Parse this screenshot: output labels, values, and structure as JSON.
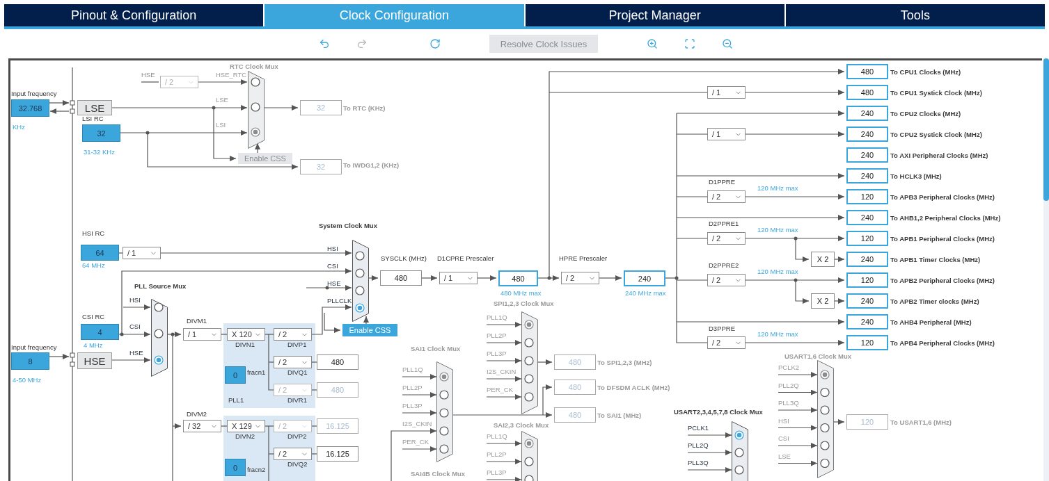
{
  "tabs": [
    {
      "label": "Pinout & Configuration",
      "selected": false
    },
    {
      "label": "Clock Configuration",
      "selected": true
    },
    {
      "label": "Project Manager",
      "selected": false
    },
    {
      "label": "Tools",
      "selected": false
    }
  ],
  "tools": [
    {
      "kind": "undo",
      "disabled": false
    },
    {
      "kind": "redo",
      "disabled": true
    },
    {
      "kind": "reset",
      "disabled": false
    },
    {
      "kind": "resolve",
      "label": "Resolve Clock Issues",
      "disabled": true
    },
    {
      "kind": "zoom-in",
      "disabled": false
    },
    {
      "kind": "fit",
      "disabled": false
    },
    {
      "kind": "zoom-out",
      "disabled": false
    }
  ],
  "diagram": {
    "labels": [
      {
        "text": "Input frequency",
        "kind": "text"
      },
      {
        "text": "KHz",
        "kind": "hint"
      },
      {
        "text": "HSE",
        "kind": "muted"
      },
      {
        "text": "LSI RC",
        "kind": "text"
      },
      {
        "text": "31-32 KHz",
        "kind": "hint"
      },
      {
        "text": "To RTC (KHz)",
        "kind": "caption"
      },
      {
        "text": "To IWDG1,2 (KHz)",
        "kind": "caption"
      },
      {
        "text": "HSI RC",
        "kind": "text"
      },
      {
        "text": "64 MHz",
        "kind": "hint"
      },
      {
        "text": "CSI RC",
        "kind": "text"
      },
      {
        "text": "Input frequency",
        "kind": "text"
      },
      {
        "text": "4 MHz",
        "kind": "hint"
      },
      {
        "text": "4-50 MHz",
        "kind": "hint"
      },
      {
        "text": "DIVM1",
        "kind": "text"
      },
      {
        "text": "DIVN1",
        "kind": "text"
      },
      {
        "text": "DIVP1",
        "kind": "text"
      },
      {
        "text": "fracn1",
        "kind": "text"
      },
      {
        "text": "DIVQ1",
        "kind": "text"
      },
      {
        "text": "PLL1",
        "kind": "text"
      },
      {
        "text": "DIVR1",
        "kind": "text"
      },
      {
        "text": "DIVM2",
        "kind": "text"
      },
      {
        "text": "DIVN2",
        "kind": "text"
      },
      {
        "text": "DIVP2",
        "kind": "text"
      },
      {
        "text": "DIVQ2",
        "kind": "text"
      },
      {
        "text": "fracn2",
        "kind": "text"
      },
      {
        "text": "SYSCLK (MHz)",
        "kind": "text"
      },
      {
        "text": "D1CPRE Prescaler",
        "kind": "text"
      },
      {
        "text": "HPRE Prescaler",
        "kind": "text"
      },
      {
        "text": "480 MHz max",
        "kind": "hint"
      },
      {
        "text": "240 MHz max",
        "kind": "hint"
      },
      {
        "text": "To SPI1,2,3 (MHz)",
        "kind": "caption"
      },
      {
        "text": "To DFSDM ACLK (MHz)",
        "kind": "caption"
      },
      {
        "text": "To SAI1 (MHz)",
        "kind": "caption"
      },
      {
        "text": "D1PPRE",
        "kind": "text"
      },
      {
        "text": "120 MHz max",
        "kind": "hint"
      },
      {
        "text": "D2PPRE1",
        "kind": "text"
      },
      {
        "text": "120 MHz max",
        "kind": "hint"
      },
      {
        "text": "D2PPRE2",
        "kind": "text"
      },
      {
        "text": "120 MHz max",
        "kind": "hint"
      },
      {
        "text": "D3PPRE",
        "kind": "text"
      },
      {
        "text": "120 MHz max",
        "kind": "hint"
      },
      {
        "text": "To USART1,6 (MHz)",
        "kind": "caption"
      },
      {
        "text": "SAI4B Clock Mux",
        "kind": "caption"
      }
    ],
    "value_boxes": [
      {
        "value": "32.768",
        "kind": "input"
      },
      {
        "value": "LSE",
        "kind": "block"
      },
      {
        "value": "32",
        "kind": "input"
      },
      {
        "value": "32",
        "kind": "inactive"
      },
      {
        "value": "32",
        "kind": "inactive"
      },
      {
        "value": "64",
        "kind": "input"
      },
      {
        "value": "4",
        "kind": "input"
      },
      {
        "value": "8",
        "kind": "input"
      },
      {
        "value": "HSE",
        "kind": "block"
      },
      {
        "value": "0",
        "kind": "input"
      },
      {
        "value": "480",
        "kind": "plain"
      },
      {
        "value": "480",
        "kind": "inactive"
      },
      {
        "value": "16.125",
        "kind": "inactive"
      },
      {
        "value": "0",
        "kind": "input"
      },
      {
        "value": "16.125",
        "kind": "plain"
      },
      {
        "value": "480",
        "kind": "plain"
      },
      {
        "value": "480",
        "kind": "result"
      },
      {
        "value": "240",
        "kind": "result"
      },
      {
        "value": "480",
        "kind": "inactive"
      },
      {
        "value": "480",
        "kind": "inactive"
      },
      {
        "value": "480",
        "kind": "inactive"
      },
      {
        "value": "X 2",
        "kind": "plain"
      },
      {
        "value": "X 2",
        "kind": "plain"
      },
      {
        "value": "120",
        "kind": "inactive"
      }
    ],
    "dropdowns": [
      {
        "value": "/ 2",
        "disabled": true
      },
      {
        "value": "/ 1",
        "disabled": false
      },
      {
        "value": "/ 1",
        "disabled": false
      },
      {
        "value": "X 120",
        "disabled": false
      },
      {
        "value": "/ 2",
        "disabled": false
      },
      {
        "value": "/ 2",
        "disabled": false
      },
      {
        "value": "/ 2",
        "disabled": true
      },
      {
        "value": "/ 32",
        "disabled": false
      },
      {
        "value": "X 129",
        "disabled": false
      },
      {
        "value": "/ 2",
        "disabled": true
      },
      {
        "value": "/ 2",
        "disabled": false
      },
      {
        "value": "/ 1",
        "disabled": false
      },
      {
        "value": "/ 2",
        "disabled": false
      },
      {
        "value": "/ 1",
        "disabled": false
      },
      {
        "value": "/ 1",
        "disabled": false
      },
      {
        "value": "/ 2",
        "disabled": false
      },
      {
        "value": "/ 2",
        "disabled": false
      },
      {
        "value": "/ 2",
        "disabled": false
      },
      {
        "value": "/ 2",
        "disabled": false
      }
    ],
    "buttons": [
      {
        "label": "Enable CSS",
        "disabled": true
      },
      {
        "label": "Enable CSS",
        "disabled": false
      }
    ],
    "muxes": [
      {
        "title": "RTC Clock Mux",
        "active": false,
        "inputs": [
          {
            "label": "HSE_RTC",
            "selected": false
          },
          {
            "label": "LSE",
            "selected": false
          },
          {
            "label": "LSI",
            "selected": true
          }
        ]
      },
      {
        "title": "System Clock Mux",
        "active": true,
        "inputs": [
          {
            "label": "HSI",
            "selected": false
          },
          {
            "label": "CSI",
            "selected": false
          },
          {
            "label": "HSE",
            "selected": false
          },
          {
            "label": "PLLCLK",
            "selected": true
          }
        ]
      },
      {
        "title": "PLL Source Mux",
        "active": true,
        "inputs": [
          {
            "label": "HSI",
            "selected": false
          },
          {
            "label": "CSI",
            "selected": false
          },
          {
            "label": "HSE",
            "selected": true
          }
        ]
      },
      {
        "title": "SPI1,2,3 Clock Mux",
        "active": false,
        "inputs": [
          {
            "label": "PLL1Q",
            "selected": true
          },
          {
            "label": "PLL2P",
            "selected": false
          },
          {
            "label": "PLL3P",
            "selected": false
          },
          {
            "label": "I2S_CKIN",
            "selected": false
          },
          {
            "label": "PER_CK",
            "selected": false
          }
        ]
      },
      {
        "title": "SAI1 Clock Mux",
        "active": false,
        "inputs": [
          {
            "label": "PLL1Q",
            "selected": true
          },
          {
            "label": "PLL2P",
            "selected": false
          },
          {
            "label": "PLL3P",
            "selected": false
          },
          {
            "label": "I2S_CKIN",
            "selected": false
          },
          {
            "label": "PER_CK",
            "selected": false
          }
        ]
      },
      {
        "title": "SAI2,3 Clock Mux",
        "active": false,
        "inputs": [
          {
            "label": "PLL1Q",
            "selected": true
          },
          {
            "label": "PLL2P",
            "selected": false
          },
          {
            "label": "PLL3P",
            "selected": false
          }
        ]
      },
      {
        "title": "USART1,6 Clock Mux",
        "active": false,
        "inputs": [
          {
            "label": "PCLK2",
            "selected": true
          },
          {
            "label": "PLL2Q",
            "selected": false
          },
          {
            "label": "PLL3Q",
            "selected": false
          },
          {
            "label": "HSI",
            "selected": false
          },
          {
            "label": "CSI",
            "selected": false
          },
          {
            "label": "LSE",
            "selected": false
          }
        ]
      },
      {
        "title": "USART2,3,4,5,7,8 Clock Mux",
        "active": true,
        "inputs": [
          {
            "label": "PCLK1",
            "selected": true
          },
          {
            "label": "PLL2Q",
            "selected": false
          },
          {
            "label": "PLL3Q",
            "selected": false
          }
        ]
      }
    ],
    "outputs": [
      {
        "value": "480",
        "label": "To CPU1 Clocks (MHz)"
      },
      {
        "value": "480",
        "label": "To CPU1 Systick Clock (MHz)"
      },
      {
        "value": "240",
        "label": "To CPU2 Clocks (MHz)"
      },
      {
        "value": "240",
        "label": "To CPU2 Systick Clock (MHz)"
      },
      {
        "value": "240",
        "label": "To AXI Peripheral Clocks (MHz)"
      },
      {
        "value": "240",
        "label": "To HCLK3 (MHz)"
      },
      {
        "value": "120",
        "label": "To APB3 Peripheral Clocks (MHz)"
      },
      {
        "value": "240",
        "label": "To AHB1,2 Peripheral Clocks (MHz)"
      },
      {
        "value": "120",
        "label": "To APB1 Peripheral Clocks (MHz)"
      },
      {
        "value": "240",
        "label": "To APB1 Timer Clocks (MHz)"
      },
      {
        "value": "120",
        "label": "To APB2 Peripheral Clocks (MHz)"
      },
      {
        "value": "240",
        "label": "To APB2 Timer clocks (MHz)"
      },
      {
        "value": "240",
        "label": "To AHB4 Peripheral (MHz)"
      },
      {
        "value": "120",
        "label": "To APB4 Peripheral Clocks (MHz)"
      }
    ]
  }
}
